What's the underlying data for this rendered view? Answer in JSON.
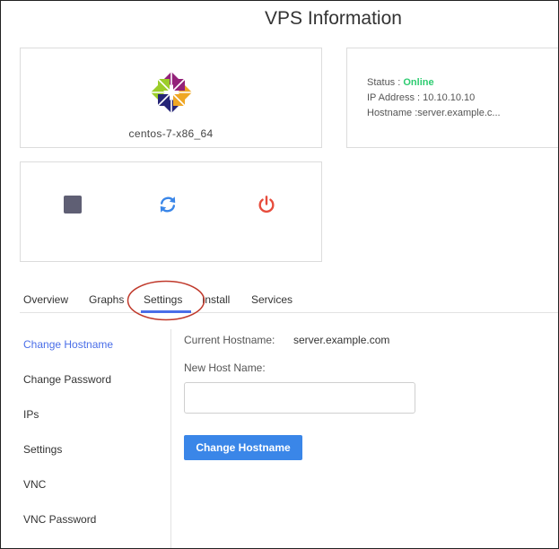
{
  "header": {
    "title": "VPS Information"
  },
  "os": {
    "name": "centos-7-x86_64",
    "logo_icon": "centos-logo-icon"
  },
  "info": {
    "status_label": "Status : ",
    "status_value": "Online",
    "ip_label": "IP Address : ",
    "ip_value": "10.10.10.10",
    "hostname_label": "Hostname :",
    "hostname_value": "server.example.c..."
  },
  "controls": [
    {
      "name": "stop",
      "icon": "stop-square-icon",
      "color": "#5f5f74"
    },
    {
      "name": "restart",
      "icon": "restart-icon",
      "color": "#3a86e8"
    },
    {
      "name": "power",
      "icon": "power-icon",
      "color": "#e74c3c"
    }
  ],
  "tabs": [
    {
      "label": "Overview"
    },
    {
      "label": "Graphs"
    },
    {
      "label": "Settings",
      "active": true
    },
    {
      "label": "Install"
    },
    {
      "label": "Services"
    }
  ],
  "sidebar": {
    "items": [
      {
        "label": "Change Hostname",
        "active": true
      },
      {
        "label": "Change Password"
      },
      {
        "label": "IPs"
      },
      {
        "label": "Settings"
      },
      {
        "label": "VNC"
      },
      {
        "label": "VNC Password"
      }
    ]
  },
  "form": {
    "current_label": "Current Hostname:",
    "current_value": "server.example.com",
    "new_label": "New Host Name:",
    "input_value": "",
    "submit_label": "Change Hostname"
  },
  "colors": {
    "accent": "#4a6ee8",
    "button": "#3a86e8",
    "online": "#2ecc71",
    "annotation": "#c0392b"
  }
}
